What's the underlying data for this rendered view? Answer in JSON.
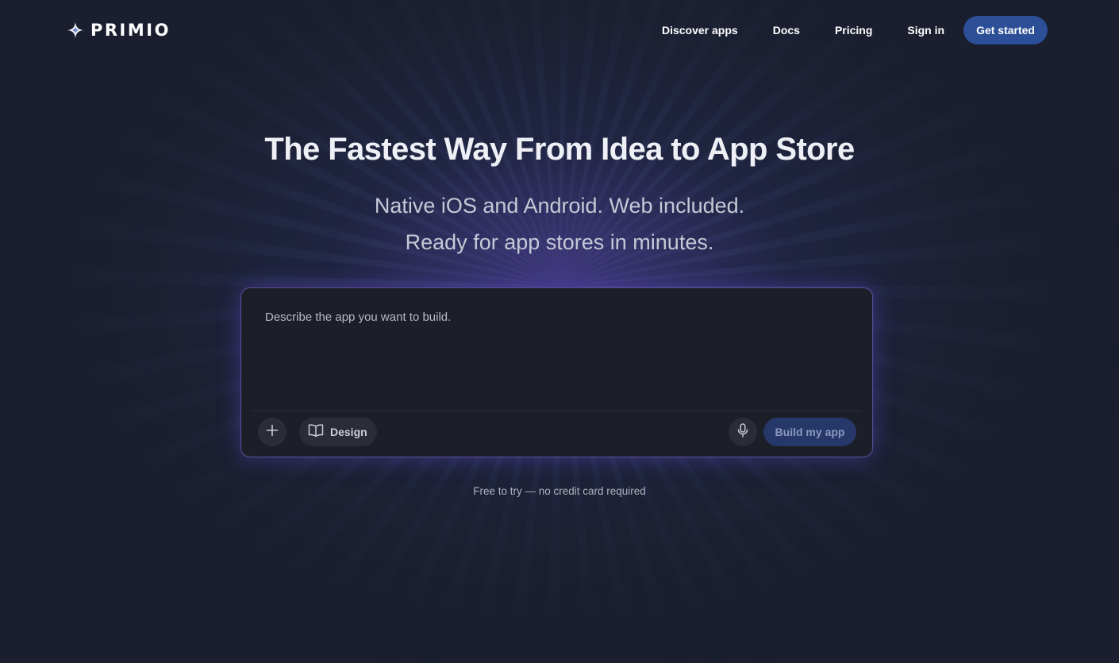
{
  "brand": {
    "name": "PRIMIO",
    "icon": "sparkle-star-icon"
  },
  "nav": {
    "links": [
      "Discover apps",
      "Docs",
      "Pricing",
      "Sign in"
    ],
    "cta_label": "Get started"
  },
  "hero": {
    "title": "The Fastest Way From Idea to App Store",
    "subtitle_line1": "Native iOS and Android. Web included.",
    "subtitle_line2": "Ready for app stores in minutes."
  },
  "prompt": {
    "placeholder": "Describe the app you want to build.",
    "value": "",
    "add_icon": "plus-icon",
    "design_label": "Design",
    "design_icon": "book-open-icon",
    "mic_icon": "microphone-icon",
    "build_label": "Build my app"
  },
  "footer_note": "Free to try — no credit card required",
  "colors": {
    "background": "#1a1e2e",
    "accent": "#2c4f98",
    "card_background": "#1c1f27",
    "build_button": "#26376a"
  }
}
